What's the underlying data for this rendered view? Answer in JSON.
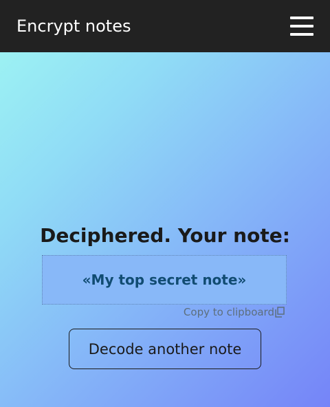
{
  "header": {
    "title": "Encrypt notes",
    "menu_icon": "hamburger-menu-icon"
  },
  "main": {
    "heading": "Deciphered. Your note:",
    "note_text": "«My top secret note»",
    "copy_label": "Copy to clipboard",
    "copy_icon": "copy-icon",
    "decode_button_label": "Decode another note"
  },
  "colors": {
    "header_background": "#222222",
    "gradient_start": "#a0f8f2",
    "gradient_end": "#7584f8",
    "note_background": "#88b8f8",
    "note_text": "#114c72"
  }
}
